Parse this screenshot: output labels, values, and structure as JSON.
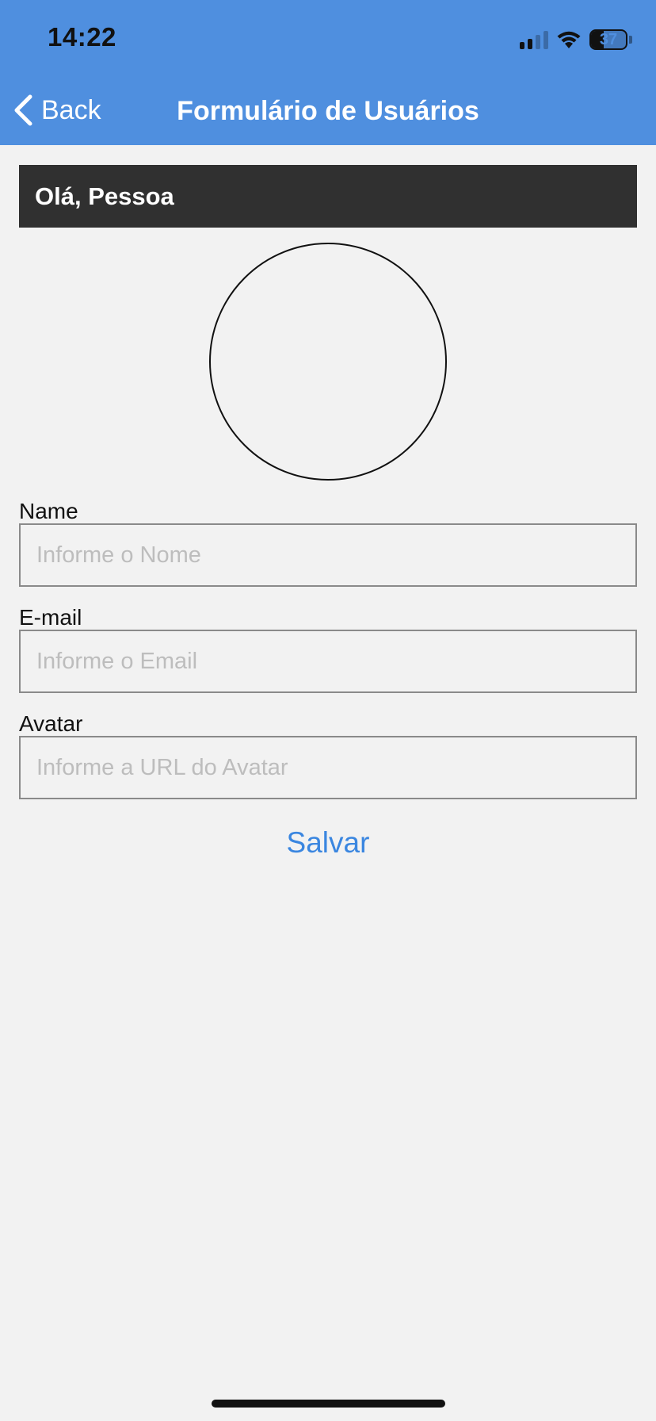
{
  "status_bar": {
    "time": "14:22",
    "battery_level": "37",
    "battery_percent": 37,
    "icons": [
      "cellular-signal-icon",
      "wifi-icon",
      "battery-icon"
    ]
  },
  "nav": {
    "back_label": "Back",
    "title": "Formulário de Usuários"
  },
  "greeting": "Olá, Pessoa",
  "form": {
    "name": {
      "label": "Name",
      "placeholder": "Informe o Nome",
      "value": ""
    },
    "email": {
      "label": "E-mail",
      "placeholder": "Informe o Email",
      "value": ""
    },
    "avatar": {
      "label": "Avatar",
      "placeholder": "Informe a URL do Avatar",
      "value": ""
    },
    "save_label": "Salvar"
  },
  "colors": {
    "header": "#4f8fdf",
    "greeting_bar": "#303030",
    "background": "#f2f2f2",
    "accent": "#3a86e0"
  }
}
